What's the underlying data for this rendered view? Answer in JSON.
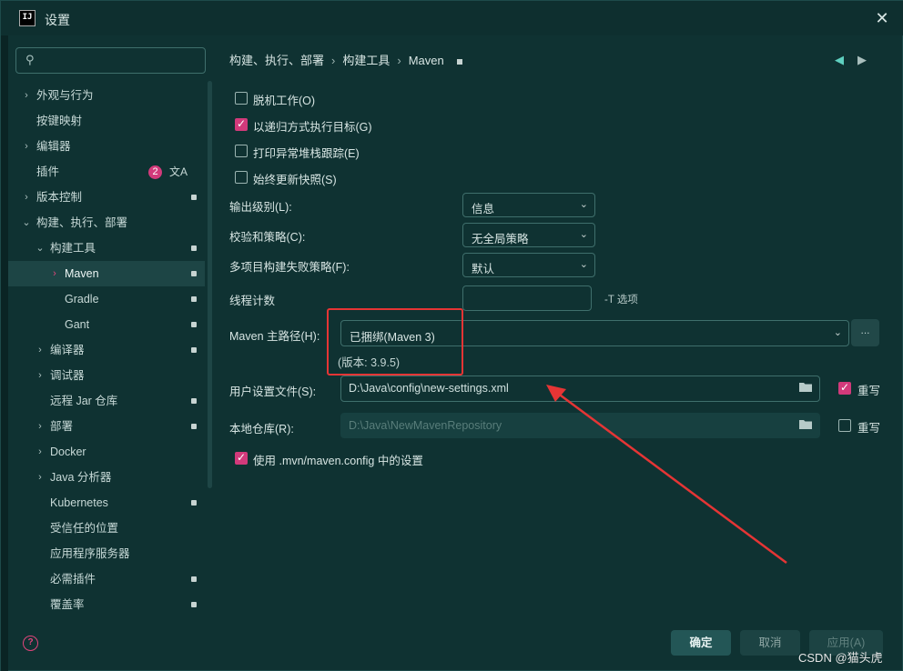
{
  "window": {
    "app_icon": "IJ",
    "title": "设置",
    "close_icon": "close-icon"
  },
  "search": {
    "placeholder": "",
    "icon": "search-icon"
  },
  "sidebar": {
    "items": [
      {
        "label": "外观与行为",
        "chevron": "right",
        "lock": false
      },
      {
        "label": "按键映射",
        "chevron": "none",
        "lock": false
      },
      {
        "label": "编辑器",
        "chevron": "right",
        "lock": false
      },
      {
        "label": "插件",
        "chevron": "none",
        "lock": false,
        "badge": "2"
      },
      {
        "label": "版本控制",
        "chevron": "right",
        "lock": true
      },
      {
        "label": "构建、执行、部署",
        "chevron": "down",
        "lock": false
      },
      {
        "label": "构建工具",
        "chevron": "down",
        "lock": true
      },
      {
        "label": "Maven",
        "chevron": "right",
        "lock": true,
        "selected": true
      },
      {
        "label": "Gradle",
        "chevron": "none",
        "lock": true
      },
      {
        "label": "Gant",
        "chevron": "none",
        "lock": true
      },
      {
        "label": "编译器",
        "chevron": "right",
        "lock": true
      },
      {
        "label": "调试器",
        "chevron": "right",
        "lock": false
      },
      {
        "label": "远程 Jar 仓库",
        "chevron": "none",
        "lock": true
      },
      {
        "label": "部署",
        "chevron": "right",
        "lock": true
      },
      {
        "label": "Docker",
        "chevron": "right",
        "lock": false
      },
      {
        "label": "Java 分析器",
        "chevron": "right",
        "lock": false
      },
      {
        "label": "Kubernetes",
        "chevron": "none",
        "lock": true
      },
      {
        "label": "受信任的位置",
        "chevron": "none",
        "lock": false
      },
      {
        "label": "应用程序服务器",
        "chevron": "none",
        "lock": false
      },
      {
        "label": "必需插件",
        "chevron": "none",
        "lock": true
      },
      {
        "label": "覆盖率",
        "chevron": "none",
        "lock": true
      }
    ]
  },
  "breadcrumb": {
    "part1": "构建、执行、部署",
    "part2": "构建工具",
    "part3": "Maven",
    "back_icon": "arrow-left-icon",
    "forward_icon": "arrow-right-icon"
  },
  "options": {
    "offline": {
      "label": "脱机工作(O)",
      "checked": false
    },
    "recursive": {
      "label": "以递归方式执行目标(G)",
      "checked": true
    },
    "print_stack": {
      "label": "打印异常堆栈跟踪(E)",
      "checked": false
    },
    "always_update": {
      "label": "始终更新快照(S)",
      "checked": false
    },
    "use_mvn_config": {
      "label": "使用 .mvn/maven.config 中的设置",
      "checked": true
    }
  },
  "fields": {
    "output_level": {
      "label": "输出级别(L):",
      "value": "信息"
    },
    "checksum": {
      "label": "校验和策略(C):",
      "value": "无全局策略"
    },
    "multiproject": {
      "label": "多项目构建失败策略(F):",
      "value": "默认"
    },
    "thread_count": {
      "label": "线程计数",
      "value": "",
      "hint": "-T 选项"
    },
    "maven_home": {
      "label": "Maven 主路径(H):",
      "value": "已捆绑(Maven 3)",
      "version": "(版本: 3.9.5)",
      "browse": "..."
    },
    "user_settings": {
      "label": "用户设置文件(S):",
      "value": "D:\\Java\\config\\new-settings.xml",
      "override_label": "重写",
      "override_checked": true
    },
    "local_repo": {
      "label": "本地仓库(R):",
      "value": "D:\\Java\\NewMavenRepository",
      "override_label": "重写",
      "override_checked": false
    }
  },
  "buttons": {
    "ok": "确定",
    "cancel": "取消",
    "apply": "应用(A)"
  },
  "watermark": "CSDN @猫头虎",
  "colors": {
    "accent": "#d23a7b",
    "background": "#0f3232",
    "annotation": "#e53535"
  }
}
